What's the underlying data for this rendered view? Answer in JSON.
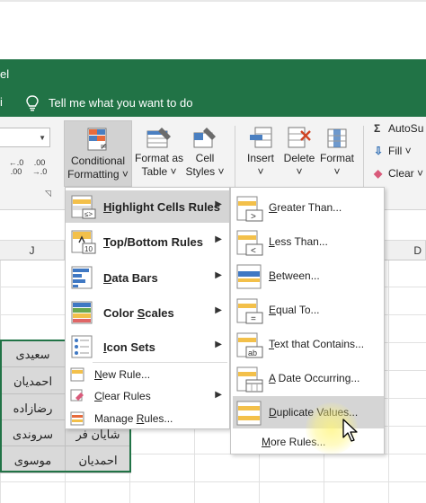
{
  "title_fragment": "el",
  "tellme": {
    "edge_fragment": "i",
    "text": "Tell me what you want to do"
  },
  "ribbon": {
    "decimal_increase": "←.0\n.00",
    "decimal_decrease": ".00\n→.0",
    "conditional_formatting": [
      "Conditional",
      "Formatting ˅"
    ],
    "format_as_table": [
      "Format as",
      "Table ˅"
    ],
    "cell_styles": [
      "Cell",
      "Styles ˅"
    ],
    "insert": [
      "Insert",
      "˅"
    ],
    "delete": [
      "Delete",
      "˅"
    ],
    "format": [
      "Format",
      "˅"
    ],
    "autosum": "AutoSu",
    "fill": "Fill ˅",
    "clear": "Clear ˅"
  },
  "columns": {
    "j": "J",
    "d": "D"
  },
  "cells": [
    [
      "سعیدی",
      ""
    ],
    [
      "احمدیان",
      ""
    ],
    [
      "رضازاده",
      ""
    ],
    [
      "سروندی",
      "شایان فر"
    ],
    [
      "موسوی",
      "احمدیان"
    ]
  ],
  "menu": {
    "items": [
      {
        "pre": "",
        "u": "H",
        "post": "ighlight Cells Rules"
      },
      {
        "pre": "",
        "u": "T",
        "post": "op/Bottom Rules"
      },
      {
        "pre": "",
        "u": "D",
        "post": "ata Bars"
      },
      {
        "pre": "Color ",
        "u": "S",
        "post": "cales"
      },
      {
        "pre": "",
        "u": "I",
        "post": "con Sets"
      }
    ],
    "small": [
      {
        "pre": "",
        "u": "N",
        "post": "ew Rule..."
      },
      {
        "pre": "",
        "u": "C",
        "post": "lear Rules"
      },
      {
        "pre": "Manage ",
        "u": "R",
        "post": "ules..."
      }
    ]
  },
  "submenu": {
    "items": [
      {
        "pre": "",
        "u": "G",
        "post": "reater Than..."
      },
      {
        "pre": "",
        "u": "L",
        "post": "ess Than..."
      },
      {
        "pre": "",
        "u": "B",
        "post": "etween..."
      },
      {
        "pre": "",
        "u": "E",
        "post": "qual To..."
      },
      {
        "pre": "",
        "u": "T",
        "post": "ext that Contains..."
      },
      {
        "pre": "",
        "u": "A",
        "post": " Date Occurring..."
      },
      {
        "pre": "",
        "u": "D",
        "post": "uplicate Values..."
      }
    ],
    "more": {
      "pre": "",
      "u": "M",
      "post": "ore Rules..."
    }
  }
}
